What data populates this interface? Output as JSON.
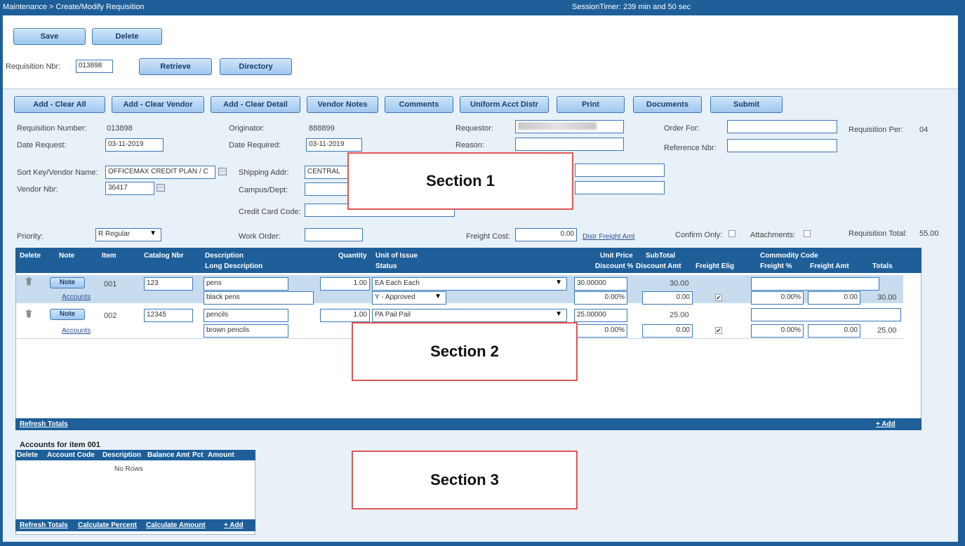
{
  "header": {
    "breadcrumb": "Maintenance > Create/Modify Requisition",
    "session_timer": "SessionTimer: 239 min and 50 sec"
  },
  "toolbar": {
    "save": "Save",
    "delete": "Delete"
  },
  "retrieve": {
    "label": "Requisition Nbr:",
    "value": "013898",
    "retrieve_button": "Retrieve",
    "directory_button": "Directory"
  },
  "actions": [
    "Add - Clear All",
    "Add - Clear Vendor",
    "Add - Clear Detail",
    "Vendor Notes",
    "Comments",
    "Uniform Acct Distr",
    "Print",
    "Documents",
    "Submit"
  ],
  "form": {
    "req_number_label": "Requisition Number:",
    "req_number_value": "013898",
    "originator_label": "Originator:",
    "originator_value": "888899",
    "requestor_label": "Requestor:",
    "order_for_label": "Order For:",
    "req_per_label": "Requisition Per:",
    "req_per_value": "04",
    "date_request_label": "Date Request:",
    "date_request_value": "03-11-2019",
    "date_required_label": "Date Required:",
    "date_required_value": "03-11-2019",
    "reason_label": "Reason:",
    "reference_label": "Reference Nbr:",
    "sort_key_label": "Sort Key/Vendor Name:",
    "sort_key_value": "OFFICEMAX CREDIT PLAN / C",
    "shipping_label": "Shipping Addr:",
    "shipping_value": "CENTRAL",
    "vendor_nbr_label": "Vendor Nbr:",
    "vendor_nbr_value": "36417",
    "campus_label": "Campus/Dept:",
    "credit_card_label": "Credit Card Code:",
    "priority_label": "Priority:",
    "priority_value": "R Regular",
    "work_order_label": "Work Order:",
    "freight_cost_label": "Freight Cost:",
    "freight_cost_value": "0.00",
    "distr_freight_link": "Distr Freight Amt",
    "confirm_only_label": "Confirm Only:",
    "attachments_label": "Attachments:",
    "req_total_label": "Requisition Total:",
    "req_total_value": "55.00"
  },
  "grid": {
    "headers_top": {
      "delete": "Delete",
      "note": "Note",
      "item": "Item",
      "catalog": "Catalog Nbr",
      "description": "Description",
      "quantity": "Quantity",
      "unit_of_issue": "Unit of Issue",
      "unit_price": "Unit Price",
      "subtotal": "SubTotal",
      "commodity_code": "Commodity Code"
    },
    "headers_bottom": {
      "long_description": "Long Description",
      "status": "Status",
      "discount_pct": "Discount %",
      "discount_amt": "Discount Amt",
      "freight_elig": "Freight Elig",
      "freight_pct": "Freight %",
      "freight_amt": "Freight Amt",
      "totals": "Totals"
    },
    "rows": [
      {
        "note": "Note",
        "item": "001",
        "catalog": "123",
        "description": "pens",
        "quantity": "1.00",
        "unit_of_issue": "EA Each Each",
        "unit_price": "30.00000",
        "subtotal": "30.00",
        "accounts": "Accounts",
        "long_description": "black pens",
        "status": "Y - Approved",
        "discount_pct": "0.00%",
        "discount_amt": "0.00",
        "freight_elig": "✔",
        "freight_pct": "0.00%",
        "freight_amt": "0.00",
        "total": "30.00"
      },
      {
        "note": "Note",
        "item": "002",
        "catalog": "12345",
        "description": "pencils",
        "quantity": "1.00",
        "unit_of_issue": "PA Pail Pail",
        "unit_price": "25.00000",
        "subtotal": "25.00",
        "accounts": "Accounts",
        "long_description": "brown pencils",
        "discount_pct": "0.00%",
        "discount_amt": "0.00",
        "freight_elig": "✔",
        "freight_pct": "0.00%",
        "freight_amt": "0.00",
        "total": "25.00"
      }
    ],
    "refresh_totals": "Refresh Totals",
    "add": "+ Add"
  },
  "accounts": {
    "title": "Accounts for item 001",
    "headers": [
      "Delete",
      "Account Code",
      "Description",
      "Balance Amt",
      "Pct",
      "Amount"
    ],
    "empty": "No Rows",
    "footer": {
      "refresh_totals": "Refresh Totals",
      "calculate_percent": "Calculate Percent",
      "calculate_amount": "Calculate Amount",
      "add": "+ Add"
    }
  },
  "sections": [
    "Section 1",
    "Section 2",
    "Section 3"
  ]
}
